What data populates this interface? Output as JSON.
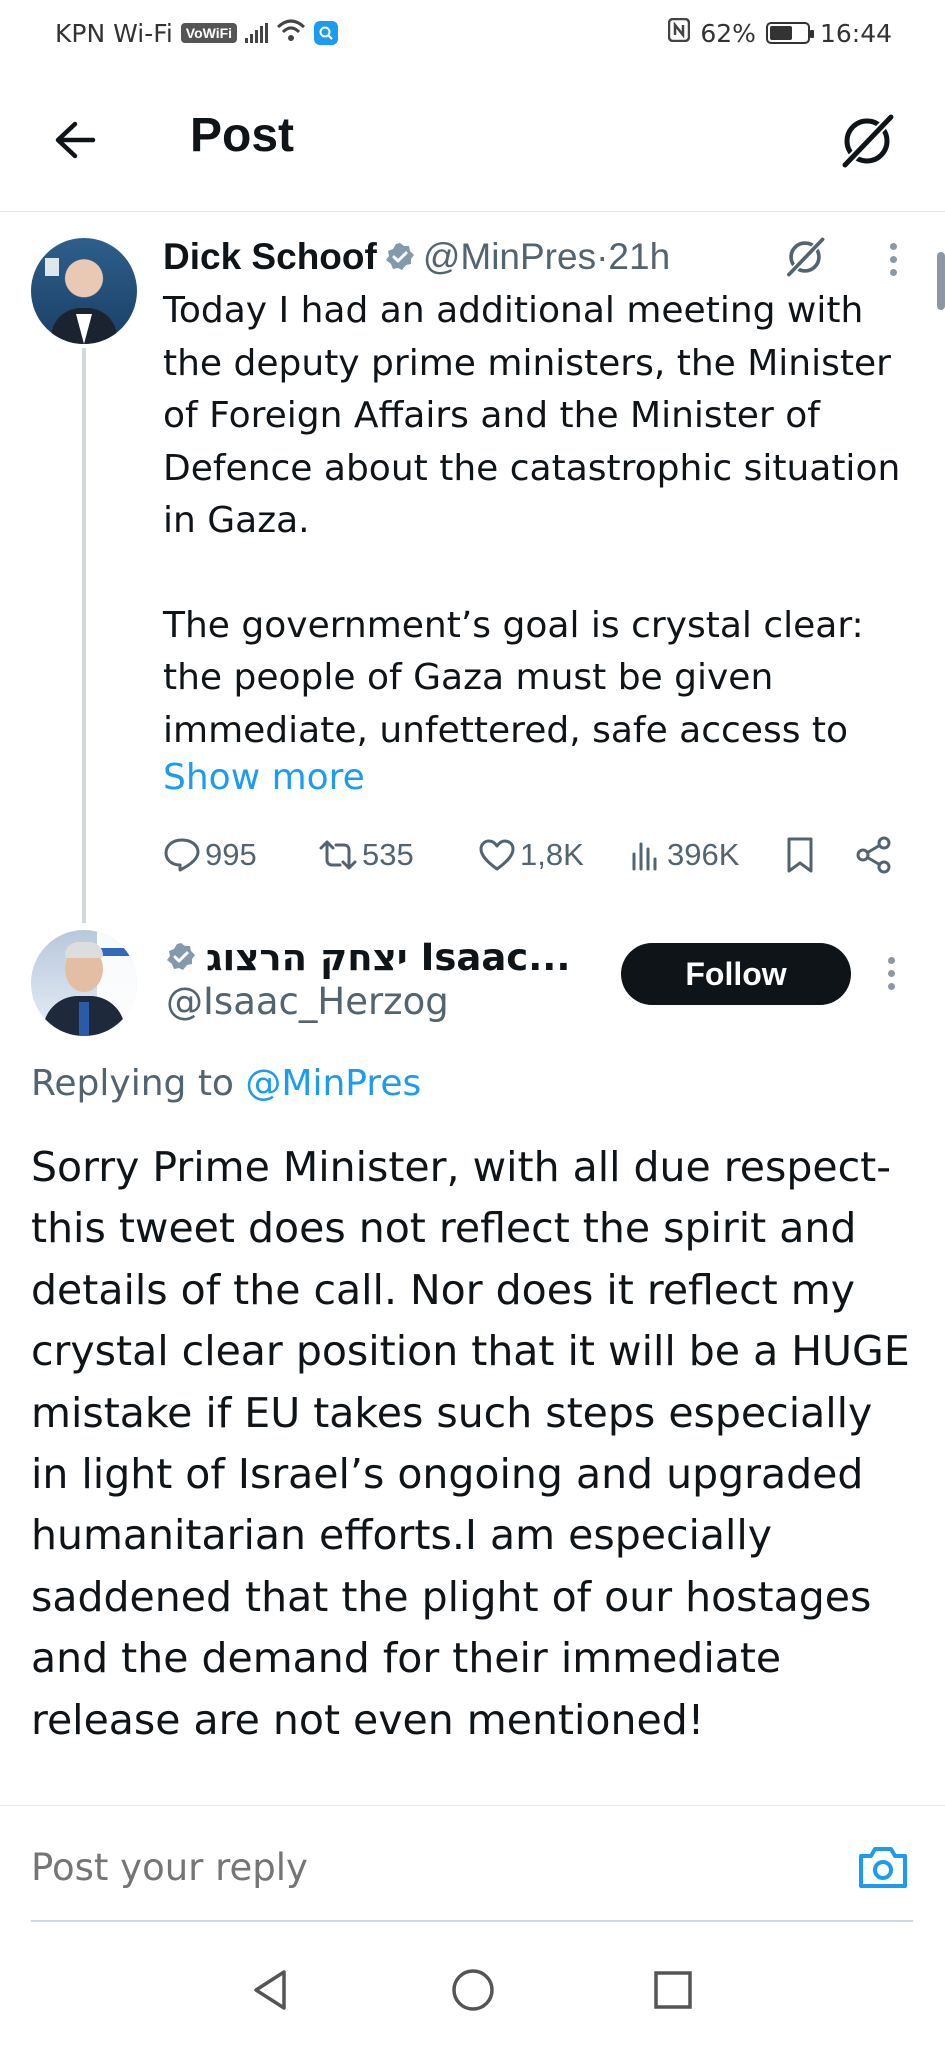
{
  "status_bar": {
    "carrier": "KPN Wi-Fi",
    "vowifi_label": "VoWiFi",
    "battery_percent": "62%",
    "battery_level": 0.62,
    "time": "16:44",
    "icons": [
      "signal-icon",
      "wifi-icon",
      "search-badge-icon",
      "nfc-icon",
      "battery-icon"
    ]
  },
  "header": {
    "title": "Post",
    "back_icon": "arrow-left-icon",
    "grok_icon": "grok-icon"
  },
  "original_post": {
    "author_name": "Dick Schoof",
    "handle": "@MinPres",
    "time_sep": " · ",
    "time": "21h",
    "paragraphs": [
      "Today I had an additional meeting with the deputy prime ministers, the Minister of Foreign Affairs and the Minister of Defence about the catastrophic situation in Gaza.",
      "The government’s goal is crystal clear: the people of Gaza must be given immediate, unfettered, safe access to"
    ],
    "show_more": "Show more",
    "stats": {
      "replies": "995",
      "reposts": "535",
      "likes": "1,8K",
      "views": "396K"
    }
  },
  "reply_post": {
    "author_name": "יצחק הרצוג Isaac...",
    "handle": "@Isaac_Herzog",
    "follow_label": "Follow",
    "replying_prefix": "Replying to ",
    "replying_to": "@MinPres",
    "text": "Sorry Prime Minister, with all due respect- this tweet does not reflect the spirit and details of the call. Nor does it reflect my crystal clear position that it will be a HUGE mistake if EU takes such steps especially in light of Israel’s ongoing and upgraded humanitarian efforts.I am especially saddened that the plight of our hostages and the demand for their immediate release are not even mentioned!"
  },
  "composer": {
    "placeholder": "Post your reply"
  },
  "colors": {
    "accent": "#1d9bf0",
    "text": "#0f1419",
    "secondary": "#536471",
    "border": "#e6e9ec"
  }
}
